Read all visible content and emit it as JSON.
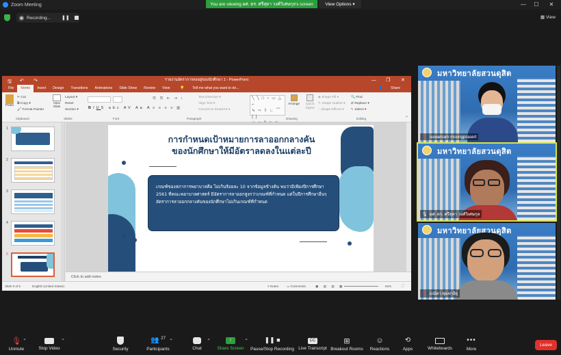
{
  "window": {
    "title": "Zoom Meeting",
    "share_banner": "You are viewing ผศ. ดร. ศรีสุดา วงศ์วิเศษกุล's screen",
    "view_options": "View Options",
    "view_label": "View",
    "recording": "Recording..."
  },
  "ppt": {
    "title": "รายงานอัตราการคงอยู่ของนักศึกษา 1 - PowerPoint",
    "tabs": [
      "File",
      "Home",
      "Insert",
      "Design",
      "Transitions",
      "Animations",
      "Slide Show",
      "Review",
      "View"
    ],
    "tell_me": "Tell me what you want to do...",
    "share": "Share",
    "ribbon": {
      "paste": "Paste",
      "cut": "Cut",
      "copy": "Copy",
      "format_painter": "Format Painter",
      "clipboard": "Clipboard",
      "new_slide": "New Slide",
      "layout": "Layout",
      "reset": "Reset",
      "section": "Section",
      "slides": "Slides",
      "font": "Font",
      "text_direction": "Text Direction",
      "align_text": "Align Text",
      "convert_smartart": "Convert to SmartArt",
      "paragraph": "Paragraph",
      "arrange": "Arrange",
      "quick_styles": "Quick Styles",
      "shape_fill": "Shape Fill",
      "shape_outline": "Shape Outline",
      "shape_effects": "Shape Effects",
      "drawing": "Drawing",
      "find": "Find",
      "replace": "Replace",
      "select": "Select",
      "editing": "Editing"
    },
    "thumb_numbers": [
      "1",
      "2",
      "3",
      "4",
      "5"
    ],
    "slide": {
      "title_line1": "การกำหนดเป้าหมายการลาออกกลางคัน",
      "title_line2": "ของนักศึกษาให้มีอัตราลดลงในแต่ละปี",
      "body": "เกณฑ์ของสภาการพยาบาลคือ ไม่เกินร้อยละ 10 จากข้อมูลข้างต้น พบว่ามีเพียงปีการศึกษา 2561 ที่คณะพยาบาลศาสตร์ มีอัตราการลาออกสูงกว่าเกณฑ์ที่กำหนด แต่ในปีการศึกษาอื่นๆ อัตราการลาออกกลางคันของนักศึกษาไม่เกินเกณฑ์ที่กำหนด"
    },
    "notes_placeholder": "Click to add notes",
    "status": {
      "slide_of": "Slide 5 of 5",
      "language": "English (United States)",
      "notes": "Notes",
      "comments": "Comments",
      "zoom": "84%"
    }
  },
  "participants": [
    {
      "name": "suwamarn moungprasert",
      "banner": "มหาวิทยาลัยสวนดุสิต"
    },
    {
      "name": "ผศ. ดร. ศรีสุดา วงศ์วิเศษกุล",
      "banner": "มหาวิทยาลัยสวนดุสิต"
    },
    {
      "name": "ธณัดา พุ่มทาอิฐ",
      "banner": "มหาวิทยาลัยสวนดุสิต"
    }
  ],
  "toolbar": {
    "unmute": "Unmute",
    "stop_video": "Stop Video",
    "security": "Security",
    "participants": "Participants",
    "participants_count": "27",
    "chat": "Chat",
    "share_screen": "Share Screen",
    "pause_recording": "Pause/Stop Recording",
    "live_transcript": "Live Transcript",
    "breakout_rooms": "Breakout Rooms",
    "reactions": "Reactions",
    "apps": "Apps",
    "whiteboards": "Whiteboards",
    "more": "More",
    "leave": "Leave"
  },
  "colors": {
    "ppt_accent": "#b7472a",
    "share_green": "#2d9e3d",
    "leave_red": "#e0312c",
    "slide_navy": "#264e7a",
    "slide_light_blue": "#7fc3dc",
    "active_speaker": "#d6e64a"
  }
}
